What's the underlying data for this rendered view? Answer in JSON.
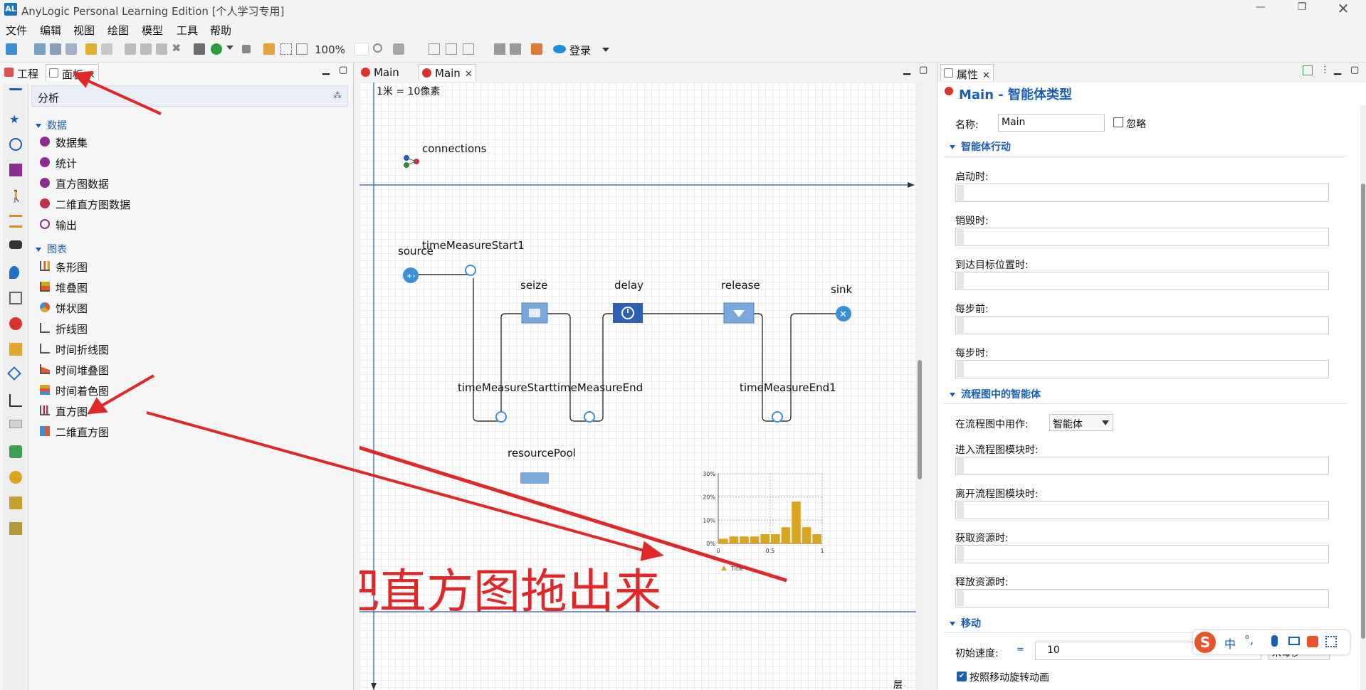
{
  "window": {
    "title": "AnyLogic Personal Learning Edition [个人学习专用]"
  },
  "menu": [
    "文件",
    "编辑",
    "视图",
    "绘图",
    "模型",
    "工具",
    "帮助"
  ],
  "toolbar": {
    "zoom": "100%",
    "login": "登录"
  },
  "left_panel": {
    "tabs": [
      "工程",
      "面板"
    ],
    "header": "分析",
    "sections": [
      {
        "title": "数据",
        "items": [
          "数据集",
          "统计",
          "直方图数据",
          "二维直方图数据",
          "输出"
        ]
      },
      {
        "title": "图表",
        "items": [
          "条形图",
          "堆叠图",
          "饼状图",
          "折线图",
          "时间折线图",
          "时间堆叠图",
          "时间着色图",
          "直方图",
          "二维直方图"
        ]
      }
    ]
  },
  "editor": {
    "tabs": [
      "Main",
      "Main"
    ],
    "scale_label": "1米 = 10像素",
    "connections_label": "connections",
    "blocks": {
      "source": "source",
      "tm_start1": "timeMeasureStart1",
      "seize": "seize",
      "delay": "delay",
      "release": "release",
      "sink": "sink",
      "tm_start": "timeMeasureStart",
      "tm_end": "timeMeasureEnd",
      "tm_end1": "timeMeasureEnd1",
      "pool": "resourcePool"
    },
    "annotation": "把直方图拖出来",
    "layers_label": "层"
  },
  "chart_data": {
    "type": "bar",
    "categories": [
      "0",
      "0.1",
      "0.2",
      "0.3",
      "0.4",
      "0.5",
      "0.6",
      "0.7",
      "0.8",
      "0.9"
    ],
    "values": [
      2,
      3,
      3,
      3,
      4,
      4,
      7,
      18,
      7,
      4
    ],
    "ylim": [
      0,
      30
    ],
    "yticks": [
      "30%",
      "20%",
      "10%",
      "0%"
    ],
    "xticks": [
      "0",
      "0.5",
      "1"
    ],
    "legend": "Title",
    "color": "#d9a520"
  },
  "properties": {
    "tab": "属性",
    "heading": "Main - 智能体类型",
    "name_label": "名称:",
    "name_value": "Main",
    "ignore_label": "忽略",
    "sections": {
      "agent_actions": "智能体行动",
      "flowchart": "流程图中的智能体",
      "movement": "移动"
    },
    "fields1": [
      "启动时:",
      "销毁时:",
      "到达目标位置时:",
      "每步前:",
      "每步时:"
    ],
    "flow_use_label": "在流程图中用作:",
    "flow_use_value": "智能体",
    "fields2": [
      "进入流程图模块时:",
      "离开流程图模块时:",
      "获取资源时:",
      "释放资源时:"
    ],
    "speed_label": "初始速度:",
    "speed_value": "10",
    "speed_unit": "米每秒",
    "rotate_label": "按照移动旋转动画"
  },
  "ime": {
    "lang": "中",
    "punct": "°,"
  }
}
